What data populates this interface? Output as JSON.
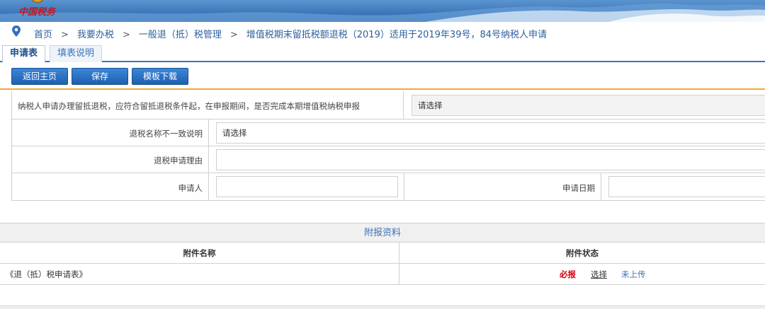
{
  "banner": {
    "logo_text": "中国税务"
  },
  "breadcrumb": {
    "items": [
      "首页",
      "我要办税",
      "一般退（抵）税管理",
      "增值税期末留抵税额退税（2019）适用于2019年39号，84号纳税人申请"
    ],
    "separator": ">"
  },
  "tabs": [
    {
      "label": "申请表",
      "active": true
    },
    {
      "label": "填表说明",
      "active": false
    }
  ],
  "toolbar": {
    "back_label": "返回主页",
    "save_label": "保存",
    "template_label": "模板下载"
  },
  "form": {
    "q1_label": "纳税人申请办理留抵退税，应符合留抵退税条件起，在申报期间，是否完成本期增值税纳税申报",
    "q1_value": "请选择",
    "name_mismatch_label": "退税名称不一致说明",
    "name_mismatch_value": "请选择",
    "reason_label": "退税申请理由",
    "reason_value": "",
    "applicant_label": "申请人",
    "applicant_value": "",
    "date_label": "申请日期",
    "date_value": ""
  },
  "attachments": {
    "title": "附报资料",
    "col_name": "附件名称",
    "col_status": "附件状态",
    "rows": [
      {
        "name": "《退（抵）税申请表》",
        "required": "必报",
        "select": "选择",
        "status": "未上传"
      }
    ]
  },
  "colors": {
    "accent_blue": "#3b73b9",
    "required_red": "#d7000f",
    "divider_orange": "#f2a83a"
  }
}
